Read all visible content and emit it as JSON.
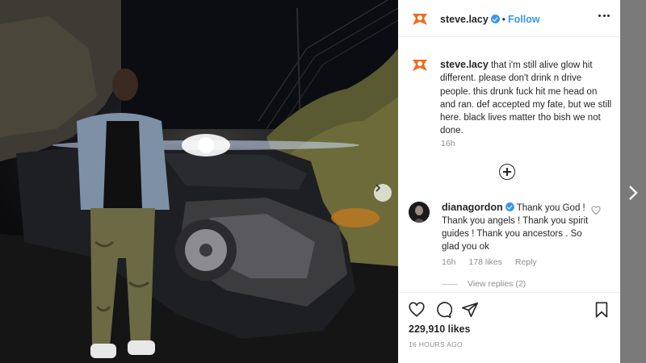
{
  "post": {
    "author": {
      "username": "steve.lacy",
      "verified": true,
      "follow_label": "Follow",
      "separator": "•"
    },
    "caption": {
      "username": "steve.lacy",
      "text": "that i'm still alive glow hit different. please don't drink n drive people. this drunk fuck hit me head on and ran. def accepted my fate, but we still here. black lives matter tho bish we not done.",
      "time": "16h"
    },
    "comments": [
      {
        "username": "dianagordon",
        "verified": true,
        "text": "Thank you God ! Thank you angels ! Thank you spirit guides ! Thank you ancestors . So glad you ok",
        "time": "16h",
        "likes": "178 likes",
        "reply_label": "Reply",
        "view_replies": "View replies (2)"
      }
    ],
    "likes": "229,910 likes",
    "time_ago": "16 HOURS AGO"
  },
  "icons": {
    "more": "more-horizontal-icon",
    "load_more": "plus-circle-icon",
    "like": "heart-icon",
    "comment": "comment-bubble-icon",
    "share": "paper-plane-icon",
    "save": "bookmark-icon",
    "next_photo": "chevron-right-icon",
    "next_post": "chevron-right-icon"
  },
  "colors": {
    "accent": "#3897f0",
    "text": "#262626",
    "muted": "#8e8e8e",
    "avatar_brand": "#f26b1d"
  }
}
